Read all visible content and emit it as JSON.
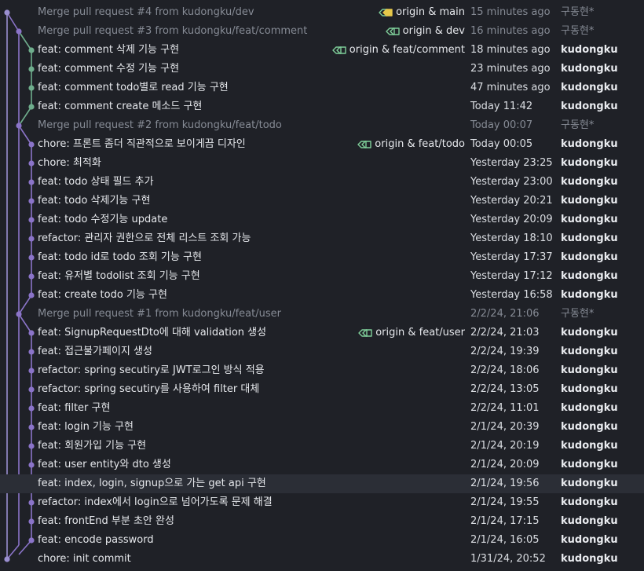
{
  "colors": {
    "background": "#1f2127",
    "selected_row": "#2b2e36",
    "lane_purple": "#8b74c9",
    "lane_green": "#6fae8d",
    "lane_main": "#9a8fd0",
    "tag_yellow": "#e6c84a",
    "tag_green": "#7fcf9a"
  },
  "commits": [
    {
      "message": "Merge pull request #4 from kudongku/dev",
      "refs": "origin & main",
      "date": "15 minutes ago",
      "author": "구동현*",
      "merge": true,
      "lane": 0,
      "tag_icon": "yellow-green"
    },
    {
      "message": "Merge pull request #3 from kudongku/feat/comment",
      "refs": "origin & dev",
      "date": "16 minutes ago",
      "author": "구동현*",
      "merge": true,
      "lane": 1,
      "tag_icon": "green"
    },
    {
      "message": "feat: comment 삭제 기능 구현",
      "refs": "origin & feat/comment",
      "date": "18 minutes ago",
      "author": "kudongku",
      "merge": false,
      "lane": 2,
      "tag_icon": "green"
    },
    {
      "message": "feat: comment 수정 기능 구현",
      "refs": "",
      "date": "23 minutes ago",
      "author": "kudongku",
      "merge": false,
      "lane": 2
    },
    {
      "message": "feat: comment todo별로 read 기능 구현",
      "refs": "",
      "date": "47 minutes ago",
      "author": "kudongku",
      "merge": false,
      "lane": 2
    },
    {
      "message": "feat: comment create 메소드 구현",
      "refs": "",
      "date": "Today 11:42",
      "author": "kudongku",
      "merge": false,
      "lane": 2
    },
    {
      "message": "Merge pull request #2 from kudongku/feat/todo",
      "refs": "",
      "date": "Today 00:07",
      "author": "구동현*",
      "merge": true,
      "lane": 1
    },
    {
      "message": "chore: 프론트 좀더 직관적으로 보이게끔 디자인",
      "refs": "origin & feat/todo",
      "date": "Today 00:05",
      "author": "kudongku",
      "merge": false,
      "lane": 2,
      "tag_icon": "green"
    },
    {
      "message": "chore: 최적화",
      "refs": "",
      "date": "Yesterday 23:25",
      "author": "kudongku",
      "merge": false,
      "lane": 2
    },
    {
      "message": "feat: todo 상태 필드 추가",
      "refs": "",
      "date": "Yesterday 23:00",
      "author": "kudongku",
      "merge": false,
      "lane": 2
    },
    {
      "message": "feat: todo 삭제기능 구현",
      "refs": "",
      "date": "Yesterday 20:21",
      "author": "kudongku",
      "merge": false,
      "lane": 2
    },
    {
      "message": "feat: todo 수정기능 update",
      "refs": "",
      "date": "Yesterday 20:09",
      "author": "kudongku",
      "merge": false,
      "lane": 2
    },
    {
      "message": "refactor: 관리자 권한으로 전체 리스트 조회 가능",
      "refs": "",
      "date": "Yesterday 18:10",
      "author": "kudongku",
      "merge": false,
      "lane": 2
    },
    {
      "message": "feat: todo id로 todo 조회 기능 구현",
      "refs": "",
      "date": "Yesterday 17:37",
      "author": "kudongku",
      "merge": false,
      "lane": 2
    },
    {
      "message": "feat:  유저별 todolist 조회 기능 구현",
      "refs": "",
      "date": "Yesterday 17:12",
      "author": "kudongku",
      "merge": false,
      "lane": 2
    },
    {
      "message": "feat: create todo 기능 구현",
      "refs": "",
      "date": "Yesterday 16:58",
      "author": "kudongku",
      "merge": false,
      "lane": 2
    },
    {
      "message": "Merge pull request #1 from kudongku/feat/user",
      "refs": "",
      "date": "2/2/24, 21:06",
      "author": "구동현*",
      "merge": true,
      "lane": 1
    },
    {
      "message": "feat: SignupRequestDto에 대해 validation 생성",
      "refs": "origin & feat/user",
      "date": "2/2/24, 21:03",
      "author": "kudongku",
      "merge": false,
      "lane": 2,
      "tag_icon": "green"
    },
    {
      "message": "feat: 접근불가페이지 생성",
      "refs": "",
      "date": "2/2/24, 19:39",
      "author": "kudongku",
      "merge": false,
      "lane": 2
    },
    {
      "message": "refactor: spring secutiry로 JWT로그인 방식 적용",
      "refs": "",
      "date": "2/2/24, 18:06",
      "author": "kudongku",
      "merge": false,
      "lane": 2
    },
    {
      "message": "refactor: spring secutiry를 사용하여 filter 대체",
      "refs": "",
      "date": "2/2/24, 13:05",
      "author": "kudongku",
      "merge": false,
      "lane": 2
    },
    {
      "message": "feat: filter 구현",
      "refs": "",
      "date": "2/2/24, 11:01",
      "author": "kudongku",
      "merge": false,
      "lane": 2
    },
    {
      "message": "feat: login 기능 구현",
      "refs": "",
      "date": "2/1/24, 20:39",
      "author": "kudongku",
      "merge": false,
      "lane": 2
    },
    {
      "message": "feat: 회원가입 기능 구현",
      "refs": "",
      "date": "2/1/24, 20:19",
      "author": "kudongku",
      "merge": false,
      "lane": 2
    },
    {
      "message": "feat: user entity와 dto 생성",
      "refs": "",
      "date": "2/1/24, 20:09",
      "author": "kudongku",
      "merge": false,
      "lane": 2
    },
    {
      "message": "feat: index, login, signup으로 가는 get api 구현",
      "refs": "",
      "date": "2/1/24, 19:56",
      "author": "kudongku",
      "merge": false,
      "lane": 2,
      "selected": true
    },
    {
      "message": "refactor: index에서 login으로 넘어가도록 문제 해결",
      "refs": "",
      "date": "2/1/24, 19:55",
      "author": "kudongku",
      "merge": false,
      "lane": 2
    },
    {
      "message": "feat: frontEnd 부분 초안 완성",
      "refs": "",
      "date": "2/1/24, 17:15",
      "author": "kudongku",
      "merge": false,
      "lane": 2
    },
    {
      "message": "feat: encode password",
      "refs": "",
      "date": "2/1/24, 16:05",
      "author": "kudongku",
      "merge": false,
      "lane": 2
    },
    {
      "message": "chore: init commit",
      "refs": "",
      "date": "1/31/24, 20:52",
      "author": "kudongku",
      "merge": false,
      "lane": 0
    }
  ]
}
